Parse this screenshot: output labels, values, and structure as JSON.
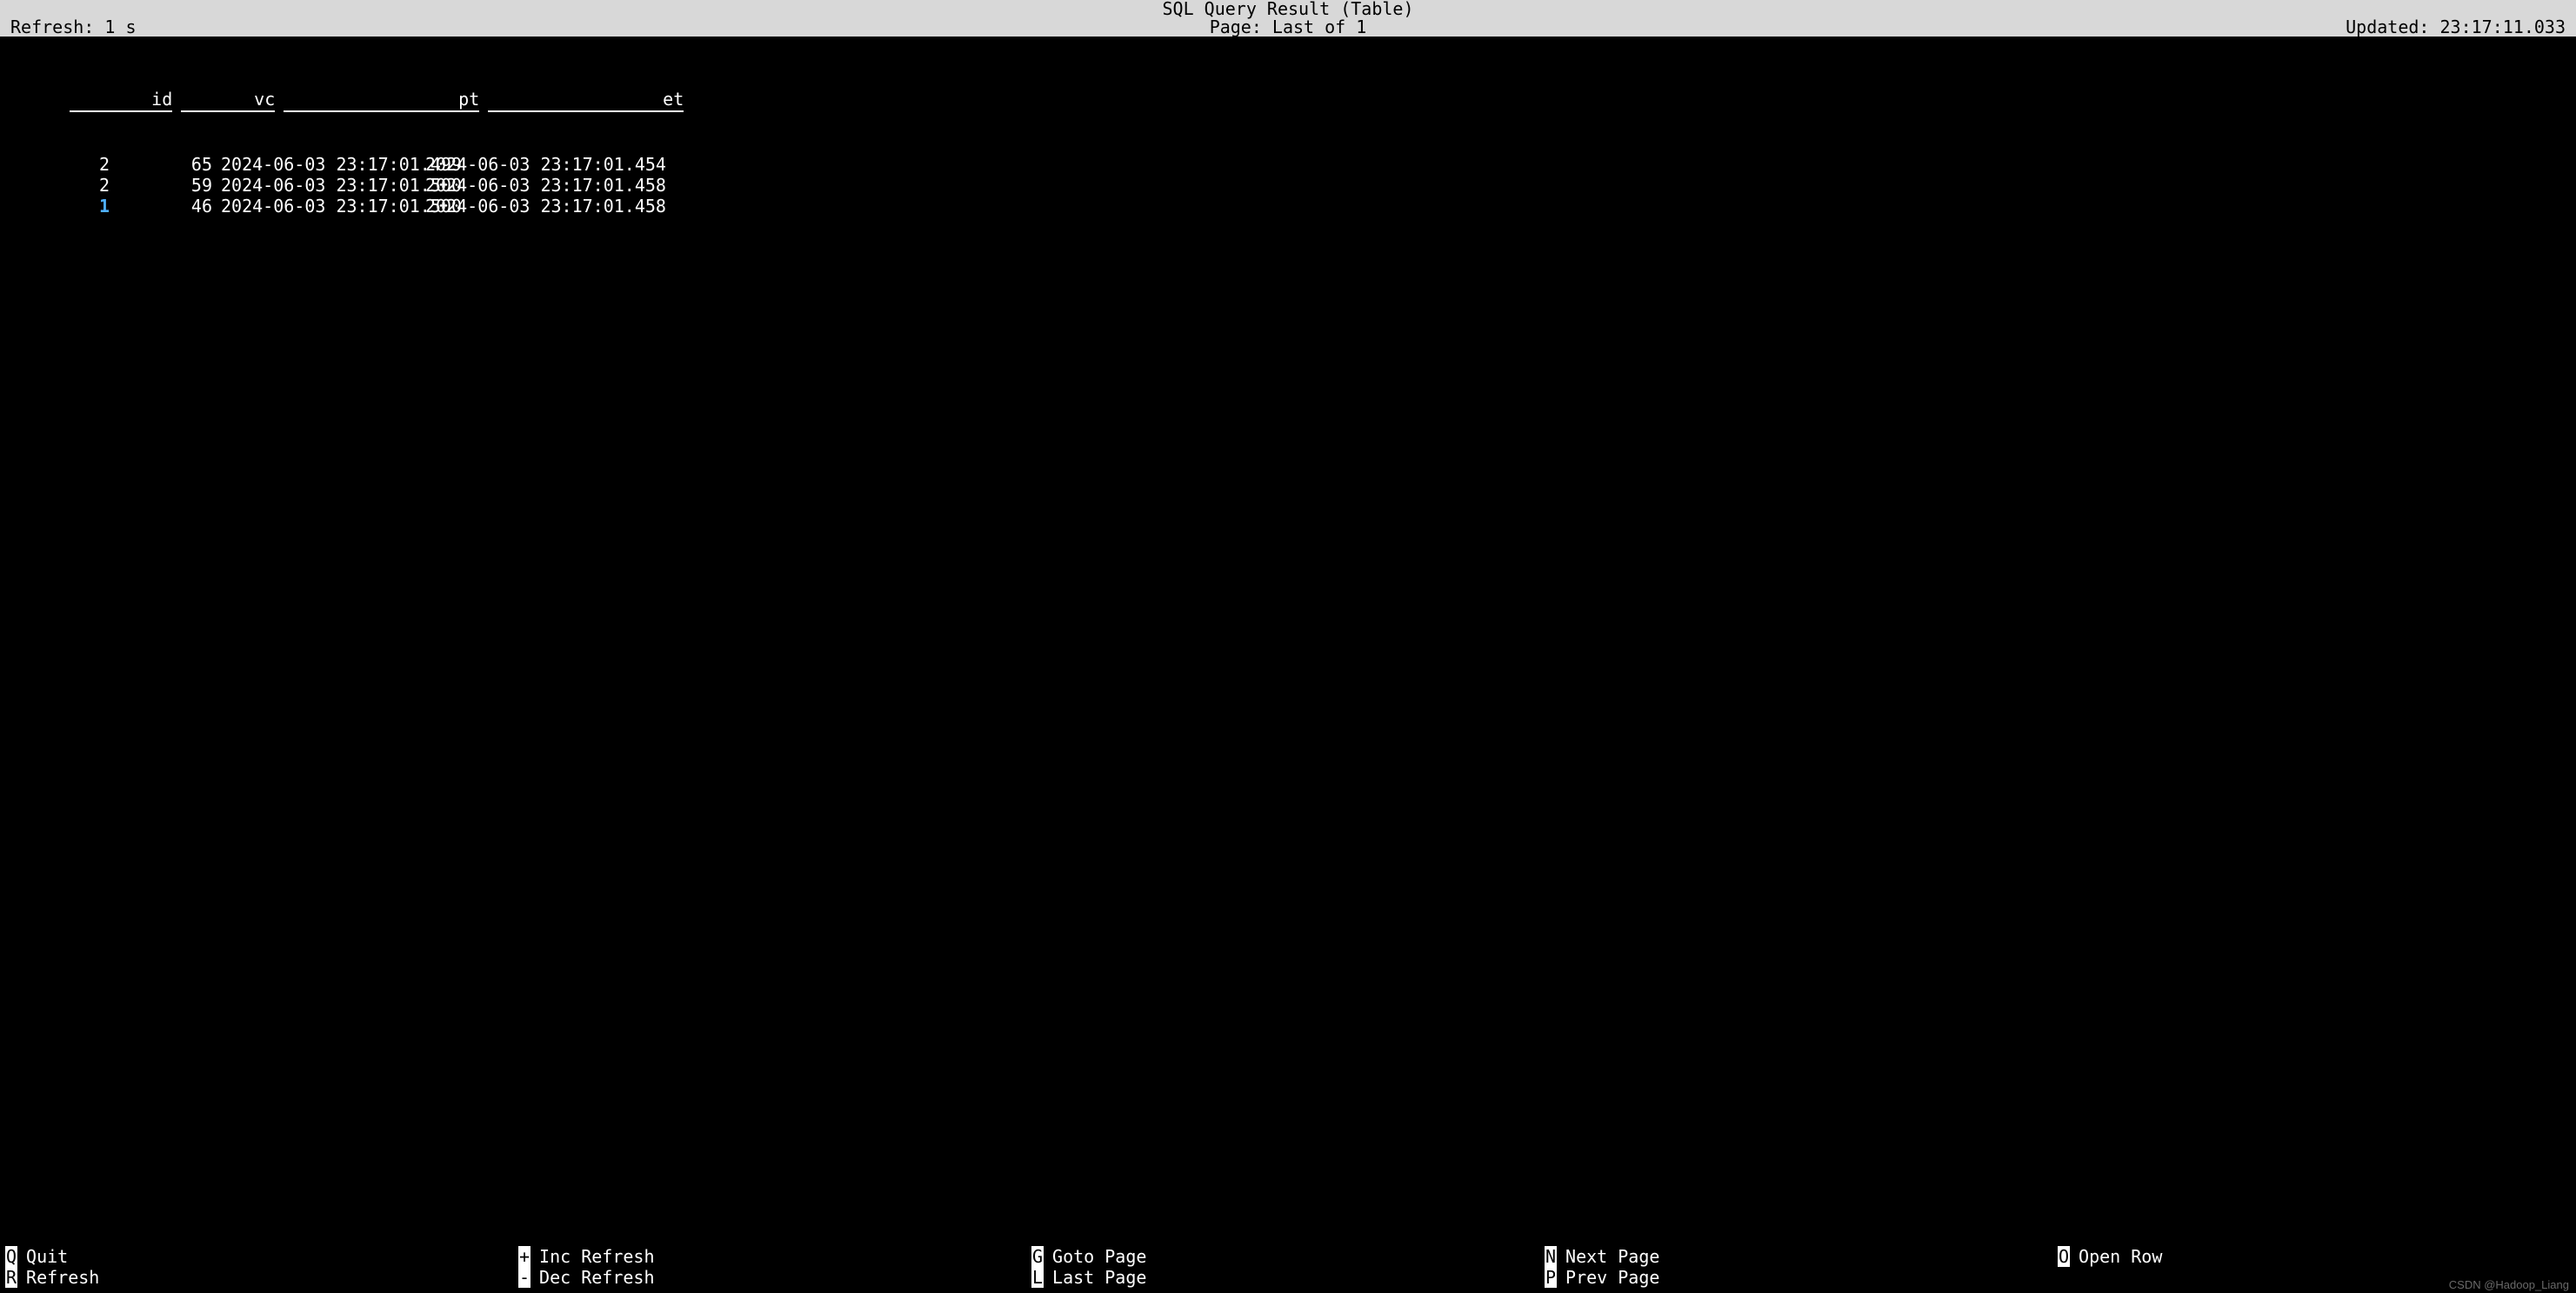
{
  "header": {
    "title": "SQL Query Result (Table)",
    "refresh_label": "Refresh: 1 s",
    "page_label": "Page: Last of 1",
    "updated_label": "Updated: 23:17:11.033"
  },
  "table": {
    "columns": {
      "id": "id",
      "vc": "vc",
      "pt": "pt",
      "et": "et"
    },
    "rows": [
      {
        "id": "2",
        "vc": "65",
        "pt": "2024-06-03 23:17:01.499",
        "et": "2024-06-03 23:17:01.454",
        "selected": false
      },
      {
        "id": "2",
        "vc": "59",
        "pt": "2024-06-03 23:17:01.500",
        "et": "2024-06-03 23:17:01.458",
        "selected": false
      },
      {
        "id": "1",
        "vc": "46",
        "pt": "2024-06-03 23:17:01.500",
        "et": "2024-06-03 23:17:01.458",
        "selected": true
      }
    ]
  },
  "footer": {
    "items": [
      {
        "key": "Q",
        "label": "Quit"
      },
      {
        "key": "+",
        "label": "Inc Refresh"
      },
      {
        "key": "G",
        "label": "Goto Page"
      },
      {
        "key": "N",
        "label": "Next Page"
      },
      {
        "key": "O",
        "label": "Open Row"
      },
      {
        "key": "R",
        "label": "Refresh"
      },
      {
        "key": "-",
        "label": "Dec Refresh"
      },
      {
        "key": "L",
        "label": "Last Page"
      },
      {
        "key": "P",
        "label": "Prev Page"
      }
    ]
  },
  "watermark": "CSDN @Hadoop_Liang"
}
